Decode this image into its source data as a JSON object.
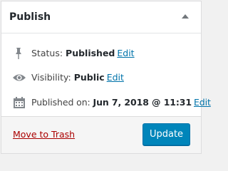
{
  "panel": {
    "title": "Publish"
  },
  "status": {
    "icon": "pin-icon",
    "label": "Status:",
    "value": "Published",
    "edit": "Edit"
  },
  "visibility": {
    "icon": "eye-icon",
    "label": "Visibility:",
    "value": "Public",
    "edit": "Edit"
  },
  "published_on": {
    "icon": "calendar-icon",
    "label": "Published on:",
    "value": "Jun 7, 2018 @ 11:31",
    "edit": "Edit"
  },
  "actions": {
    "trash": "Move to Trash",
    "update": "Update"
  },
  "colors": {
    "link": "#0073aa",
    "trash": "#aa0000",
    "primary_button": "#0085ba",
    "icon": "#82878c"
  }
}
